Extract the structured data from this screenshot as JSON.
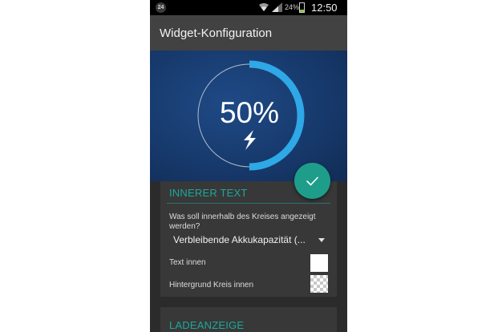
{
  "status_bar": {
    "notification_badge": "24",
    "battery_percent": "24%",
    "battery_level": 0.24,
    "time": "12:50",
    "icons": [
      "wifi-icon",
      "signal-icon",
      "battery-icon"
    ]
  },
  "action_bar": {
    "title": "Widget-Konfiguration"
  },
  "preview": {
    "percent_text": "50%",
    "ring_fill": 0.5,
    "ring_color": "#2ea8e6",
    "icon": "lightning-bolt-icon"
  },
  "fab": {
    "icon": "check-icon",
    "color": "#1e9e8a"
  },
  "inner_text_section": {
    "header": "INNERER TEXT",
    "question": "Was soll innerhalb des Kreises angezeigt werden?",
    "selected_value": "Verbleibende Akkukapazität (...",
    "text_inside_label": "Text innen",
    "text_inside_color": "#ffffff",
    "background_label": "Hintergrund Kreis innen",
    "background_color": "transparent"
  },
  "charge_section": {
    "header": "LADEANZEIGE"
  },
  "accent_color": "#1aa99c"
}
